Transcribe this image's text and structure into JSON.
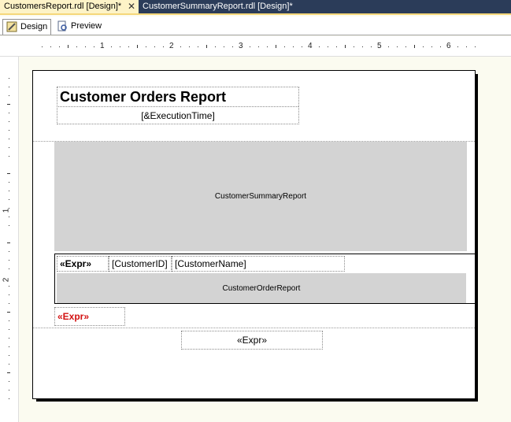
{
  "tabs": [
    {
      "label": "CustomersReport.rdl [Design]*",
      "active": true
    },
    {
      "label": "CustomerSummaryReport.rdl [Design]*",
      "active": false
    }
  ],
  "view_tabs": {
    "design": "Design",
    "preview": "Preview"
  },
  "ruler": {
    "horizontal": [
      "1",
      "2",
      "3",
      "4",
      "5",
      "6"
    ],
    "vertical": [
      "1",
      "2"
    ]
  },
  "report": {
    "title": "Customer Orders Report",
    "execution_time": "[&ExecutionTime]",
    "summary_subreport": "CustomerSummaryReport",
    "row_expr": "«Expr»",
    "customer_id": "[CustomerID]",
    "customer_name": "[CustomerName]",
    "order_subreport": "CustomerOrderReport",
    "red_expr": "«Expr»",
    "footer_expr": "«Expr»"
  },
  "colors": {
    "tab_bar": "#2b3c59",
    "active_tab": "#fdf3c7",
    "canvas": "#fbfbf0",
    "subreport_fill": "#d3d3d3",
    "expr_red": "#d21010"
  }
}
